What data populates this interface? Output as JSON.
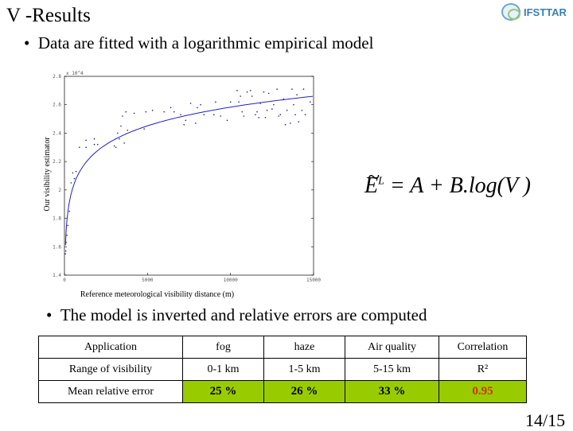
{
  "title": "V -Results",
  "logo_text": "IFSTTAR",
  "bullets": [
    "Data are fitted with a logarithmic empirical model",
    "The model is inverted and relative errors are computed"
  ],
  "formula": {
    "lhs": "E",
    "sup": "L",
    "rhs": "= A + B.log(V )"
  },
  "chart_data": {
    "type": "scatter",
    "xlabel": "Reference meteorological visibility distance (m)",
    "ylabel": "Our visibility estimator",
    "y_multiplier": "x 10^4",
    "xlim": [
      0,
      15000
    ],
    "ylim": [
      1.4,
      2.8
    ],
    "xticks": [
      "0",
      "5000",
      "10000",
      "15000"
    ],
    "yticks": [
      "1.4",
      "1.6",
      "1.8",
      "2",
      "2.2",
      "2.4",
      "2.6",
      "2.8"
    ],
    "grid": false,
    "point_color": "#1a1a80",
    "fit_color": "#2020c0",
    "fit": {
      "model": "A + B.log(V)",
      "A": 0.833,
      "B": 0.19
    },
    "points": [
      [
        50,
        1.55
      ],
      [
        80,
        1.57
      ],
      [
        100,
        1.63
      ],
      [
        150,
        1.68
      ],
      [
        200,
        1.75
      ],
      [
        300,
        1.85
      ],
      [
        400,
        2.05
      ],
      [
        500,
        2.12
      ],
      [
        600,
        2.08
      ],
      [
        700,
        2.13
      ],
      [
        900,
        2.3
      ],
      [
        1300,
        2.3
      ],
      [
        1300,
        2.35
      ],
      [
        1800,
        2.36
      ],
      [
        1800,
        2.32
      ],
      [
        2000,
        2.32
      ],
      [
        3000,
        2.31
      ],
      [
        3100,
        2.3
      ],
      [
        3200,
        2.4
      ],
      [
        3300,
        2.36
      ],
      [
        3400,
        2.45
      ],
      [
        3500,
        2.52
      ],
      [
        3600,
        2.33
      ],
      [
        3700,
        2.55
      ],
      [
        3800,
        2.42
      ],
      [
        4200,
        2.54
      ],
      [
        4800,
        2.43
      ],
      [
        4900,
        2.55
      ],
      [
        5300,
        2.56
      ],
      [
        6000,
        2.55
      ],
      [
        6400,
        2.58
      ],
      [
        6600,
        2.55
      ],
      [
        7000,
        2.53
      ],
      [
        7200,
        2.46
      ],
      [
        7300,
        2.49
      ],
      [
        7600,
        2.61
      ],
      [
        7900,
        2.47
      ],
      [
        8000,
        2.58
      ],
      [
        8200,
        2.6
      ],
      [
        8400,
        2.53
      ],
      [
        9000,
        2.53
      ],
      [
        9100,
        2.62
      ],
      [
        9400,
        2.52
      ],
      [
        9800,
        2.49
      ],
      [
        10000,
        2.62
      ],
      [
        10400,
        2.7
      ],
      [
        10500,
        2.62
      ],
      [
        10600,
        2.66
      ],
      [
        10700,
        2.55
      ],
      [
        10800,
        2.52
      ],
      [
        11000,
        2.69
      ],
      [
        11200,
        2.7
      ],
      [
        11300,
        2.66
      ],
      [
        11500,
        2.53
      ],
      [
        11600,
        2.55
      ],
      [
        11700,
        2.51
      ],
      [
        11800,
        2.61
      ],
      [
        12000,
        2.69
      ],
      [
        12100,
        2.51
      ],
      [
        12200,
        2.56
      ],
      [
        12300,
        2.68
      ],
      [
        12500,
        2.57
      ],
      [
        12600,
        2.6
      ],
      [
        12800,
        2.71
      ],
      [
        12900,
        2.52
      ],
      [
        13000,
        2.53
      ],
      [
        13200,
        2.64
      ],
      [
        13300,
        2.46
      ],
      [
        13400,
        2.56
      ],
      [
        13600,
        2.47
      ],
      [
        13700,
        2.71
      ],
      [
        13800,
        2.6
      ],
      [
        13900,
        2.53
      ],
      [
        14000,
        2.67
      ],
      [
        14100,
        2.48
      ],
      [
        14300,
        2.56
      ],
      [
        14400,
        2.71
      ],
      [
        14500,
        2.53
      ],
      [
        14800,
        2.62
      ]
    ]
  },
  "table": {
    "header": [
      "Application",
      "fog",
      "haze",
      "Air quality",
      "Correlation"
    ],
    "rows": [
      [
        "Range of visibility",
        "0-1 km",
        "1-5 km",
        "5-15 km",
        "R²"
      ],
      [
        "Mean relative error",
        "25 %",
        "26 %",
        "33 %",
        "0.95"
      ]
    ],
    "highlight_color": "#99cc00",
    "correlation_color": "#cc3300"
  },
  "page_number": "14/15"
}
